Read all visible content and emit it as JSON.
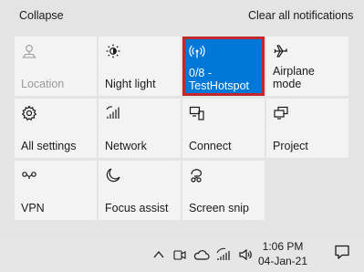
{
  "header": {
    "collapse": "Collapse",
    "clear_all": "Clear all notifications"
  },
  "tiles": [
    {
      "label": "Location",
      "icon": "location-icon",
      "state": "disabled"
    },
    {
      "label": "Night light",
      "icon": "night-light-icon",
      "state": "normal"
    },
    {
      "label": "0/8 - TestHotspot",
      "line1": "0/8 -",
      "line2": "TestHotspot",
      "icon": "hotspot-icon",
      "state": "active"
    },
    {
      "label": "Airplane mode",
      "icon": "airplane-icon",
      "state": "normal"
    },
    {
      "label": "All settings",
      "icon": "gear-icon",
      "state": "normal"
    },
    {
      "label": "Network",
      "icon": "network-icon",
      "state": "normal"
    },
    {
      "label": "Connect",
      "icon": "connect-icon",
      "state": "normal"
    },
    {
      "label": "Project",
      "icon": "project-icon",
      "state": "normal"
    },
    {
      "label": "VPN",
      "icon": "vpn-icon",
      "state": "normal"
    },
    {
      "label": "Focus assist",
      "icon": "moon-icon",
      "state": "normal"
    },
    {
      "label": "Screen snip",
      "icon": "screen-snip-icon",
      "state": "normal"
    }
  ],
  "taskbar": {
    "time": "1:06 PM",
    "date": "04-Jan-21",
    "tray_icons": [
      "chevron-up-icon",
      "meet-now-icon",
      "onedrive-cloud-icon",
      "wifi-icon",
      "volume-icon"
    ],
    "notification_icon": "action-center-icon"
  },
  "colors": {
    "active_tile": "#0078d7",
    "highlight_border": "#c1272d",
    "tile_bg": "#f3f3f3",
    "panel_bg": "#e4e4e4"
  }
}
